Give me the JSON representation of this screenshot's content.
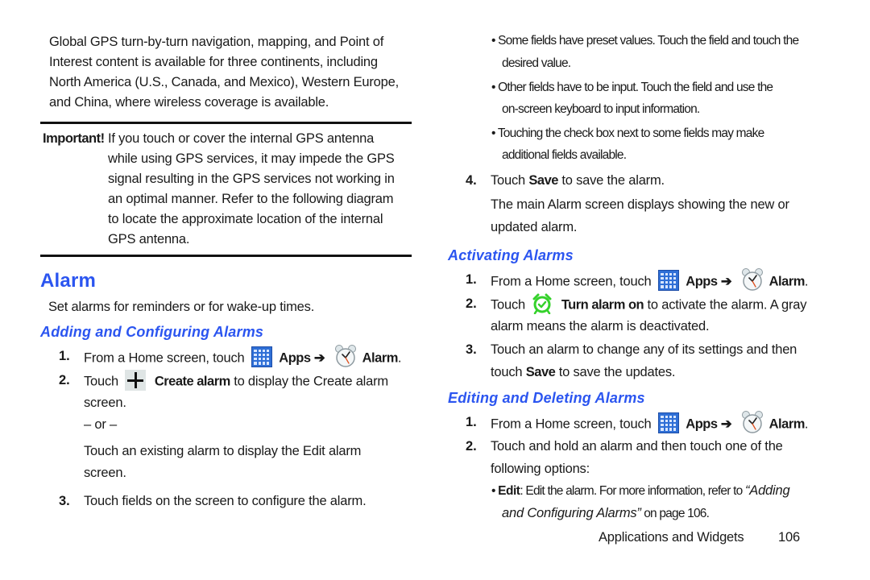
{
  "left": {
    "intro": [
      "Global GPS turn-by-turn navigation, mapping, and Point of",
      "Interest content is available for three continents, including",
      "North America (U.S., Canada, and Mexico), Western Europe,",
      "and China, where wireless coverage is available."
    ],
    "important": {
      "label": "Important!",
      "lines": [
        "If you touch or cover the internal GPS antenna",
        "while using GPS services, it may impede the GPS",
        "signal resulting in the GPS services not working in",
        "an optimal manner. Refer to the following diagram",
        "to locate the approximate location of the internal",
        "GPS antenna."
      ]
    },
    "section_title": "Alarm",
    "section_intro": "Set alarms for reminders or for wake-up times.",
    "adding": {
      "title": "Adding and Configuring Alarms",
      "step1": {
        "num": "1.",
        "pre": "From a Home screen, touch",
        "apps": "Apps",
        "arrow": "➔",
        "alarm": "Alarm",
        "post": "."
      },
      "step2": {
        "num": "2.",
        "pre": "Touch",
        "bold": "Create alarm",
        "post": "to display the Create alarm",
        "line2": "screen."
      },
      "or": "– or –",
      "alt": [
        "Touch an existing alarm to display the Edit alarm",
        "screen."
      ],
      "step3": {
        "num": "3.",
        "text": "Touch fields on the screen to configure the alarm."
      }
    }
  },
  "right": {
    "bullets": [
      [
        "Some fields have preset values. Touch the field and touch the",
        "desired value."
      ],
      [
        "Other fields have to be input. Touch the field and use the",
        "on-screen keyboard to input information."
      ],
      [
        "Touching the check box next to some fields may make",
        "additional fields available."
      ]
    ],
    "step4": {
      "num": "4.",
      "pre": "Touch",
      "bold": "Save",
      "post": "to save the alarm."
    },
    "step4_note": [
      "The main Alarm screen displays showing the new or",
      "updated alarm."
    ],
    "activating": {
      "title": "Activating Alarms",
      "step1": {
        "num": "1.",
        "pre": "From a Home screen, touch",
        "apps": "Apps",
        "arrow": "➔",
        "alarm": "Alarm",
        "post": "."
      },
      "step2": {
        "num": "2.",
        "pre": "Touch",
        "bold": "Turn alarm on",
        "post": "to activate the alarm. A gray",
        "line2": "alarm means the alarm is deactivated."
      },
      "step3": {
        "num": "3.",
        "line1": "Touch an alarm to change any of its settings and then",
        "pre2": "touch",
        "bold": "Save",
        "post2": "to save the updates."
      }
    },
    "editing": {
      "title": "Editing and Deleting Alarms",
      "step1": {
        "num": "1.",
        "pre": "From a Home screen, touch",
        "apps": "Apps",
        "arrow": "➔",
        "alarm": "Alarm",
        "post": "."
      },
      "step2": {
        "num": "2.",
        "line1": "Touch and hold an alarm and then touch one of the",
        "line2": "following options:"
      },
      "bullet": {
        "bold": "Edit",
        "text": ": Edit the alarm. For more information, refer to",
        "link1": "“Adding",
        "link2": "and Configuring Alarms”",
        "post": "on page 106."
      }
    }
  },
  "footer": {
    "section": "Applications and Widgets",
    "page": "106"
  },
  "colors": {
    "heading": "#2b55f0",
    "apps_icon": "#2f6fd6",
    "turn_on_icon": "#35d12b",
    "clock_hand": "#e0501e"
  }
}
